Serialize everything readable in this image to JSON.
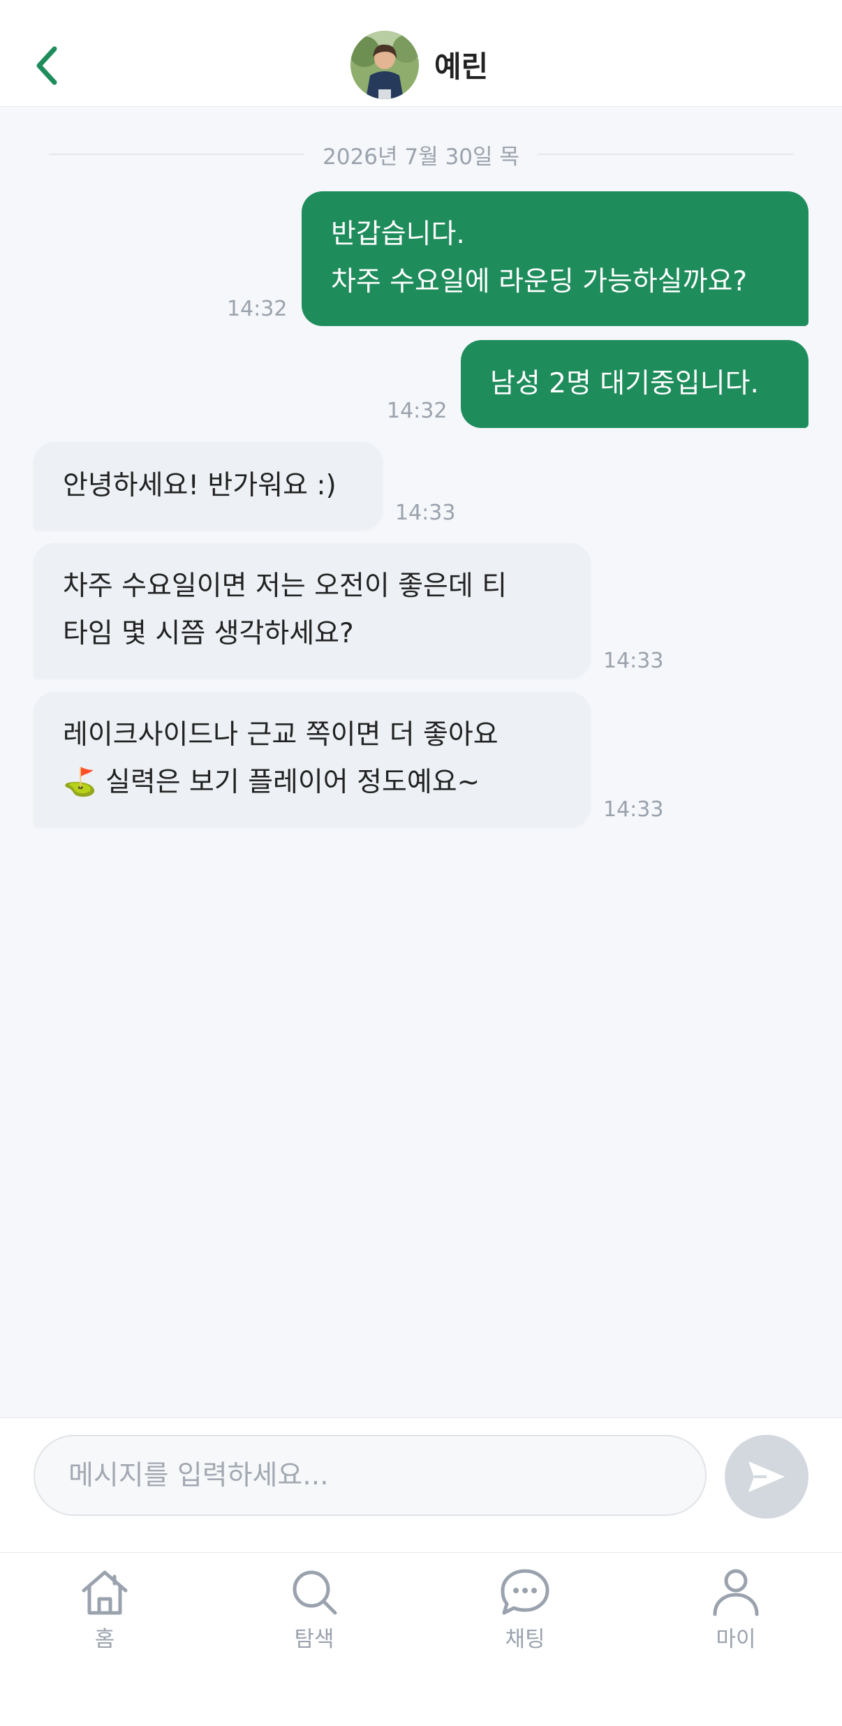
{
  "header": {
    "back_icon": "chevron-left-icon",
    "title": "예린",
    "accent_color": "#1f8c5c"
  },
  "chat": {
    "date_divider": "2026년 7월 30일 목",
    "messages": [
      {
        "direction": "out",
        "lines": [
          "반갑습니다.",
          "차주 수요일에 라운딩 가능하실까요?"
        ],
        "time": "14:32"
      },
      {
        "direction": "out",
        "lines": [
          "남성 2명 대기중입니다."
        ],
        "time": "14:32"
      },
      {
        "direction": "in",
        "lines": [
          "안녕하세요! 반가워요 :)"
        ],
        "time": "14:33"
      },
      {
        "direction": "in",
        "lines": [
          "차주 수요일이면 저는 오전이 좋은데 티",
          "타임 몇 시쯤 생각하세요?"
        ],
        "time": "14:33"
      },
      {
        "direction": "in",
        "lines": [
          "레이크사이드나 근교 쪽이면 더 좋아요",
          "⛳ 실력은 보기 플레이어 정도예요~"
        ],
        "time": "14:33"
      }
    ]
  },
  "composer": {
    "placeholder": "메시지를 입력하세요...",
    "value": "",
    "send_icon": "send-icon"
  },
  "tabbar": {
    "items": [
      {
        "label": "홈",
        "icon": "home-icon"
      },
      {
        "label": "탐색",
        "icon": "search-icon"
      },
      {
        "label": "채팅",
        "icon": "chat-icon"
      },
      {
        "label": "마이",
        "icon": "person-icon"
      }
    ]
  }
}
